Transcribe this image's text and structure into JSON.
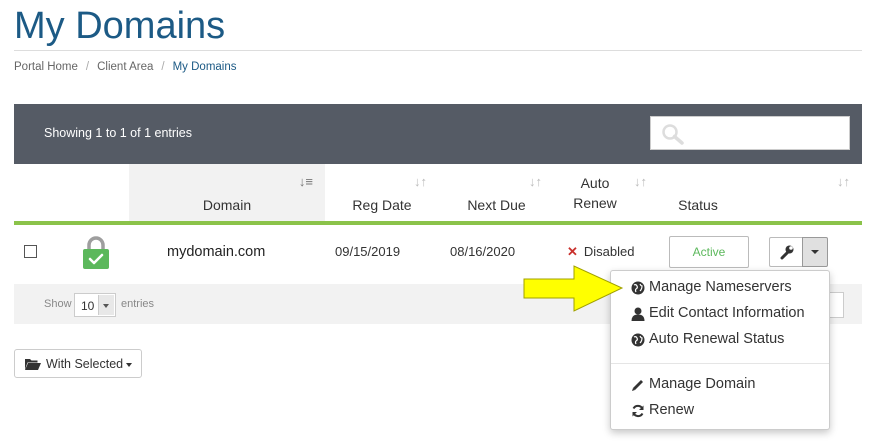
{
  "page": {
    "title": "My Domains"
  },
  "breadcrumb": [
    {
      "label": "Portal Home"
    },
    {
      "label": "Client Area"
    },
    {
      "label": "My Domains"
    }
  ],
  "table": {
    "info": "Showing 1 to 1 of 1 entries",
    "search_placeholder": "",
    "columns": {
      "domain": "Domain",
      "reg_date": "Reg Date",
      "next_due": "Next Due",
      "auto_renew": "Auto Renew",
      "status": "Status"
    },
    "rows": [
      {
        "domain": "mydomain.com",
        "reg_date": "09/15/2019",
        "next_due": "08/16/2020",
        "auto_renew": "Disabled",
        "status": "Active"
      }
    ],
    "footer": {
      "show_label": "Show",
      "page_length": "10",
      "entries_label": "entries"
    }
  },
  "with_selected": {
    "label": "With Selected"
  },
  "dropdown_menu": {
    "items": [
      {
        "label": "Manage Nameservers",
        "icon": "globe-icon"
      },
      {
        "label": "Edit Contact Information",
        "icon": "user-icon"
      },
      {
        "label": "Auto Renewal Status",
        "icon": "globe-icon"
      },
      {
        "label": "Manage Domain",
        "icon": "pencil-icon"
      },
      {
        "label": "Renew",
        "icon": "refresh-icon"
      }
    ]
  },
  "colors": {
    "title": "#1c5a85",
    "toolbar": "#555b65",
    "accent_green": "#8bc34a",
    "active_status": "#5cb85c",
    "disabled_x": "#c9302c",
    "annotation_arrow": "#ffff00"
  }
}
